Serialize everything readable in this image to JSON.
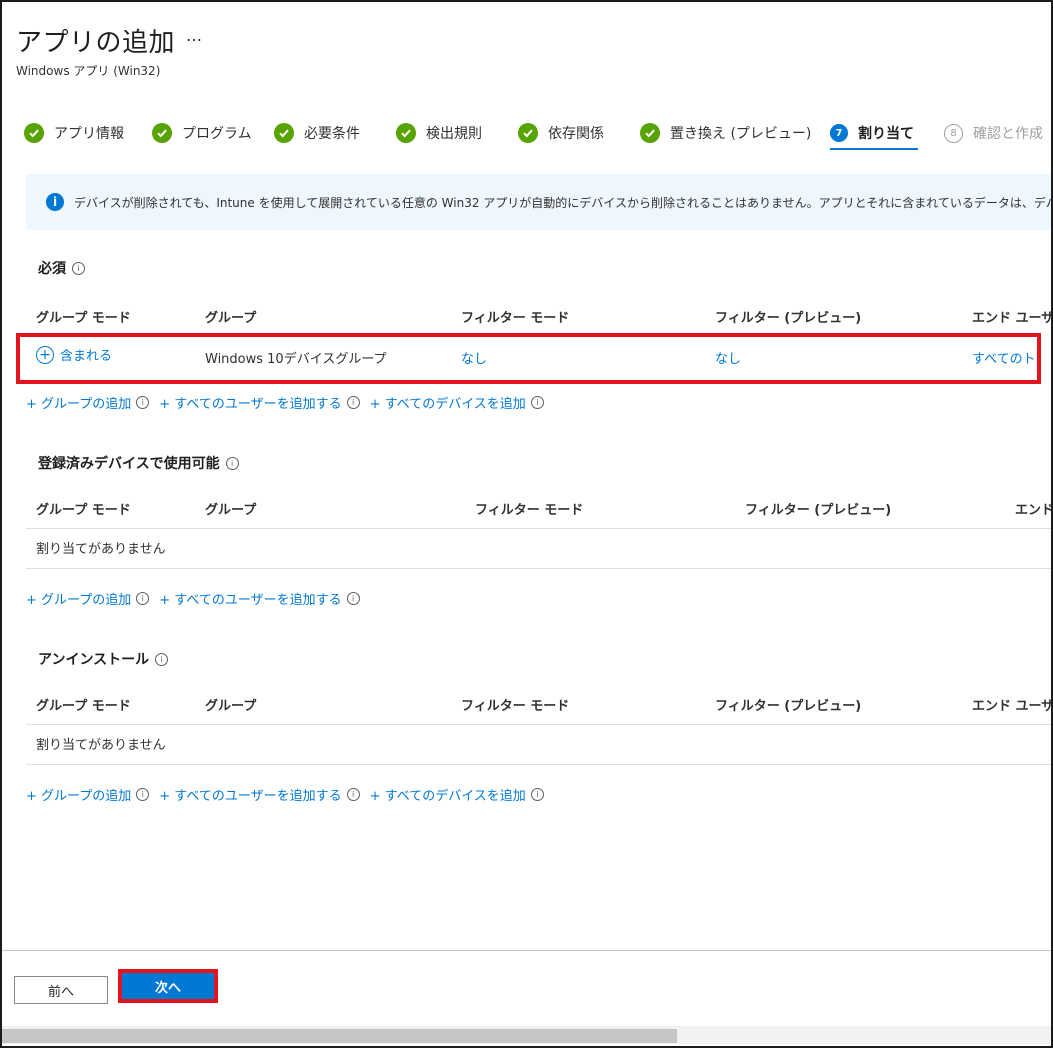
{
  "header": {
    "title": "アプリの追加",
    "more": "…",
    "subtitle": "Windows アプリ (Win32)"
  },
  "steps": [
    {
      "label": "アプリ情報",
      "state": "done"
    },
    {
      "label": "プログラム",
      "state": "done"
    },
    {
      "label": "必要条件",
      "state": "done"
    },
    {
      "label": "検出規則",
      "state": "done"
    },
    {
      "label": "依存関係",
      "state": "done"
    },
    {
      "label": "置き換え (プレビュー)",
      "state": "done"
    },
    {
      "label": "割り当て",
      "number": "7",
      "state": "current"
    },
    {
      "label": "確認と作成",
      "number": "8",
      "state": "disabled"
    }
  ],
  "info": {
    "icon": "info-icon",
    "text": "デバイスが削除されても、Intune を使用して展開されている任意の Win32 アプリが自動的にデバイスから削除されることはありません。アプリとそれに含まれているデータは、デバイス上に残"
  },
  "required": {
    "title": "必須",
    "columns": [
      "グループ モード",
      "グループ",
      "フィルター モード",
      "フィルター (プレビュー)",
      "エンド ユーザー"
    ],
    "row": {
      "mode": "含まれる",
      "group": "Windows 10デバイスグループ",
      "filter_mode": "なし",
      "filter": "なし",
      "end_user": "すべてのトース"
    },
    "links": [
      "+ グループの追加",
      "+ すべてのユーザーを追加する",
      "+ すべてのデバイスを追加"
    ]
  },
  "available": {
    "title": "登録済みデバイスで使用可能",
    "columns": [
      "グループ モード",
      "グループ",
      "フィルター モード",
      "フィルター (プレビュー)",
      "エンド"
    ],
    "empty": "割り当てがありません",
    "links": [
      "+ グループの追加",
      "+ すべてのユーザーを追加する"
    ]
  },
  "uninstall": {
    "title": "アンインストール",
    "columns": [
      "グループ モード",
      "グループ",
      "フィルター モード",
      "フィルター (プレビュー)",
      "エンド ユーザー"
    ],
    "empty": "割り当てがありません",
    "links": [
      "+ グループの追加",
      "+ すべてのユーザーを追加する",
      "+ すべてのデバイスを追加"
    ]
  },
  "footer": {
    "prev_label": "前へ",
    "next_label": "次へ"
  },
  "colors": {
    "accent": "#0078d4",
    "success": "#57a300",
    "highlight": "#e3141b"
  }
}
